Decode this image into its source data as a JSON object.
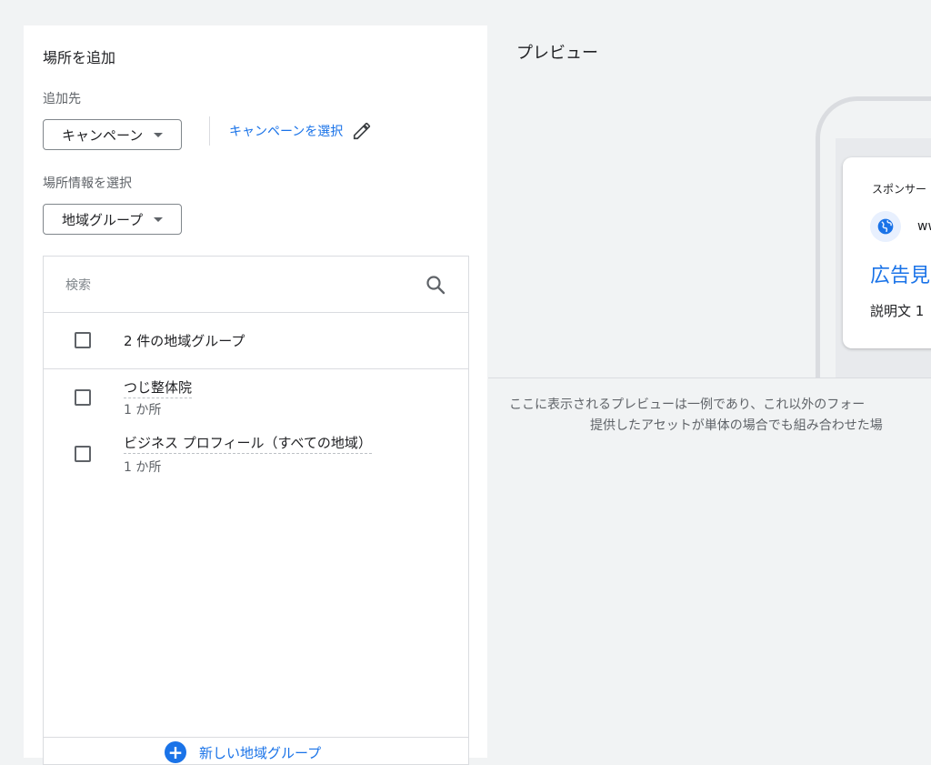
{
  "left_panel": {
    "title": "場所を追加",
    "add_to_label": "追加先",
    "campaign_dropdown": "キャンペーン",
    "select_campaign_link": "キャンペーンを選択",
    "location_info_label": "場所情報を選択",
    "location_dropdown": "地域グループ",
    "search": {
      "placeholder": "検索"
    },
    "group_header": "2 件の地域グループ",
    "items": [
      {
        "name": "つじ整体院",
        "count": "1 か所"
      },
      {
        "name": "ビジネス プロフィール（すべての地域）",
        "count": "1 か所"
      }
    ],
    "add_group_button": "新しい地域グループ"
  },
  "preview": {
    "title": "プレビュー",
    "ad": {
      "sponsor": "スポンサー",
      "url": "ww",
      "headline": "広告見",
      "description": "説明文 1"
    },
    "note_line1": "ここに表示されるプレビューは一例であり、これ以外のフォー",
    "note_line2": "提供したアセットが単体の場合でも組み合わせた場"
  },
  "colors": {
    "accent": "#1a73e8",
    "background": "#f1f3f4"
  },
  "icons": [
    "chevron-down-icon",
    "pencil-icon",
    "search-icon",
    "checkbox-icon",
    "add-circle-icon",
    "globe-icon"
  ]
}
